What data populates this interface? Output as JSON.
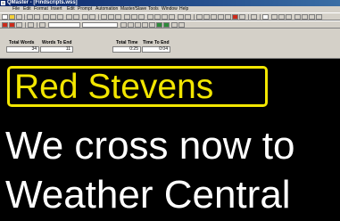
{
  "window": {
    "title": "QMaster - [Findscripts.wss]"
  },
  "menu": [
    "File",
    "Edit",
    "Format",
    "Insert",
    "Edit",
    "Prompt",
    "Automation",
    "Master/Slave",
    "Tools",
    "Window",
    "Help"
  ],
  "stats": {
    "total_words_label": "Total Words",
    "total_words_value": "34",
    "words_to_end_label": "Words To End",
    "words_to_end_value": "11",
    "total_time_label": "Total Time",
    "total_time_value": "0:25",
    "time_to_end_label": "Time To End",
    "time_to_end_value": "0:04"
  },
  "prompter": {
    "speaker": "Red Stevens",
    "lines": [
      "We cross now to",
      "Weather Central"
    ]
  },
  "colors": {
    "speaker": "#f2e600",
    "script_text": "#ffffff",
    "background": "#000000"
  }
}
